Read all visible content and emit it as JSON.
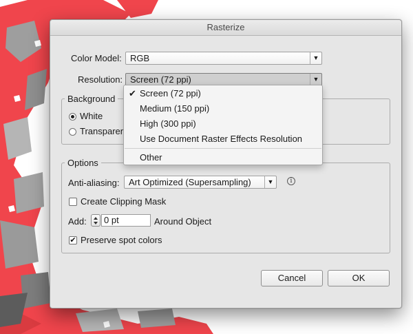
{
  "dialog": {
    "title": "Rasterize",
    "color_model": {
      "label": "Color Model:",
      "value": "RGB"
    },
    "resolution": {
      "label": "Resolution:",
      "value": "Screen (72 ppi)"
    },
    "background": {
      "title": "Background",
      "options": [
        {
          "label": "White",
          "selected": true
        },
        {
          "label": "Transparent",
          "selected": false
        }
      ]
    },
    "options_group": {
      "title": "Options",
      "anti_aliasing": {
        "label": "Anti-aliasing:",
        "value": "Art Optimized (Supersampling)"
      },
      "create_clipping_mask": {
        "label": "Create Clipping Mask",
        "checked": false
      },
      "add": {
        "label": "Add:",
        "value": "0 pt",
        "suffix": "Around Object"
      },
      "preserve_spot_colors": {
        "label": "Preserve spot colors",
        "checked": true
      }
    },
    "buttons": {
      "cancel": "Cancel",
      "ok": "OK"
    },
    "resolution_menu": {
      "items": [
        {
          "label": "Screen (72 ppi)",
          "checked": true
        },
        {
          "label": "Medium (150 ppi)",
          "checked": false
        },
        {
          "label": "High (300 ppi)",
          "checked": false
        },
        {
          "label": "Use Document Raster Effects Resolution",
          "checked": false
        },
        {
          "label": "Other",
          "checked": false
        }
      ]
    }
  },
  "glyphs": {
    "arrow": "▼",
    "check": "✔",
    "info": "i"
  },
  "colors": {
    "art_red": "#f0454c",
    "art_gray": "#9e9e9e",
    "art_dark": "#5c5c5c",
    "dialog_bg": "#e6e6e6"
  }
}
